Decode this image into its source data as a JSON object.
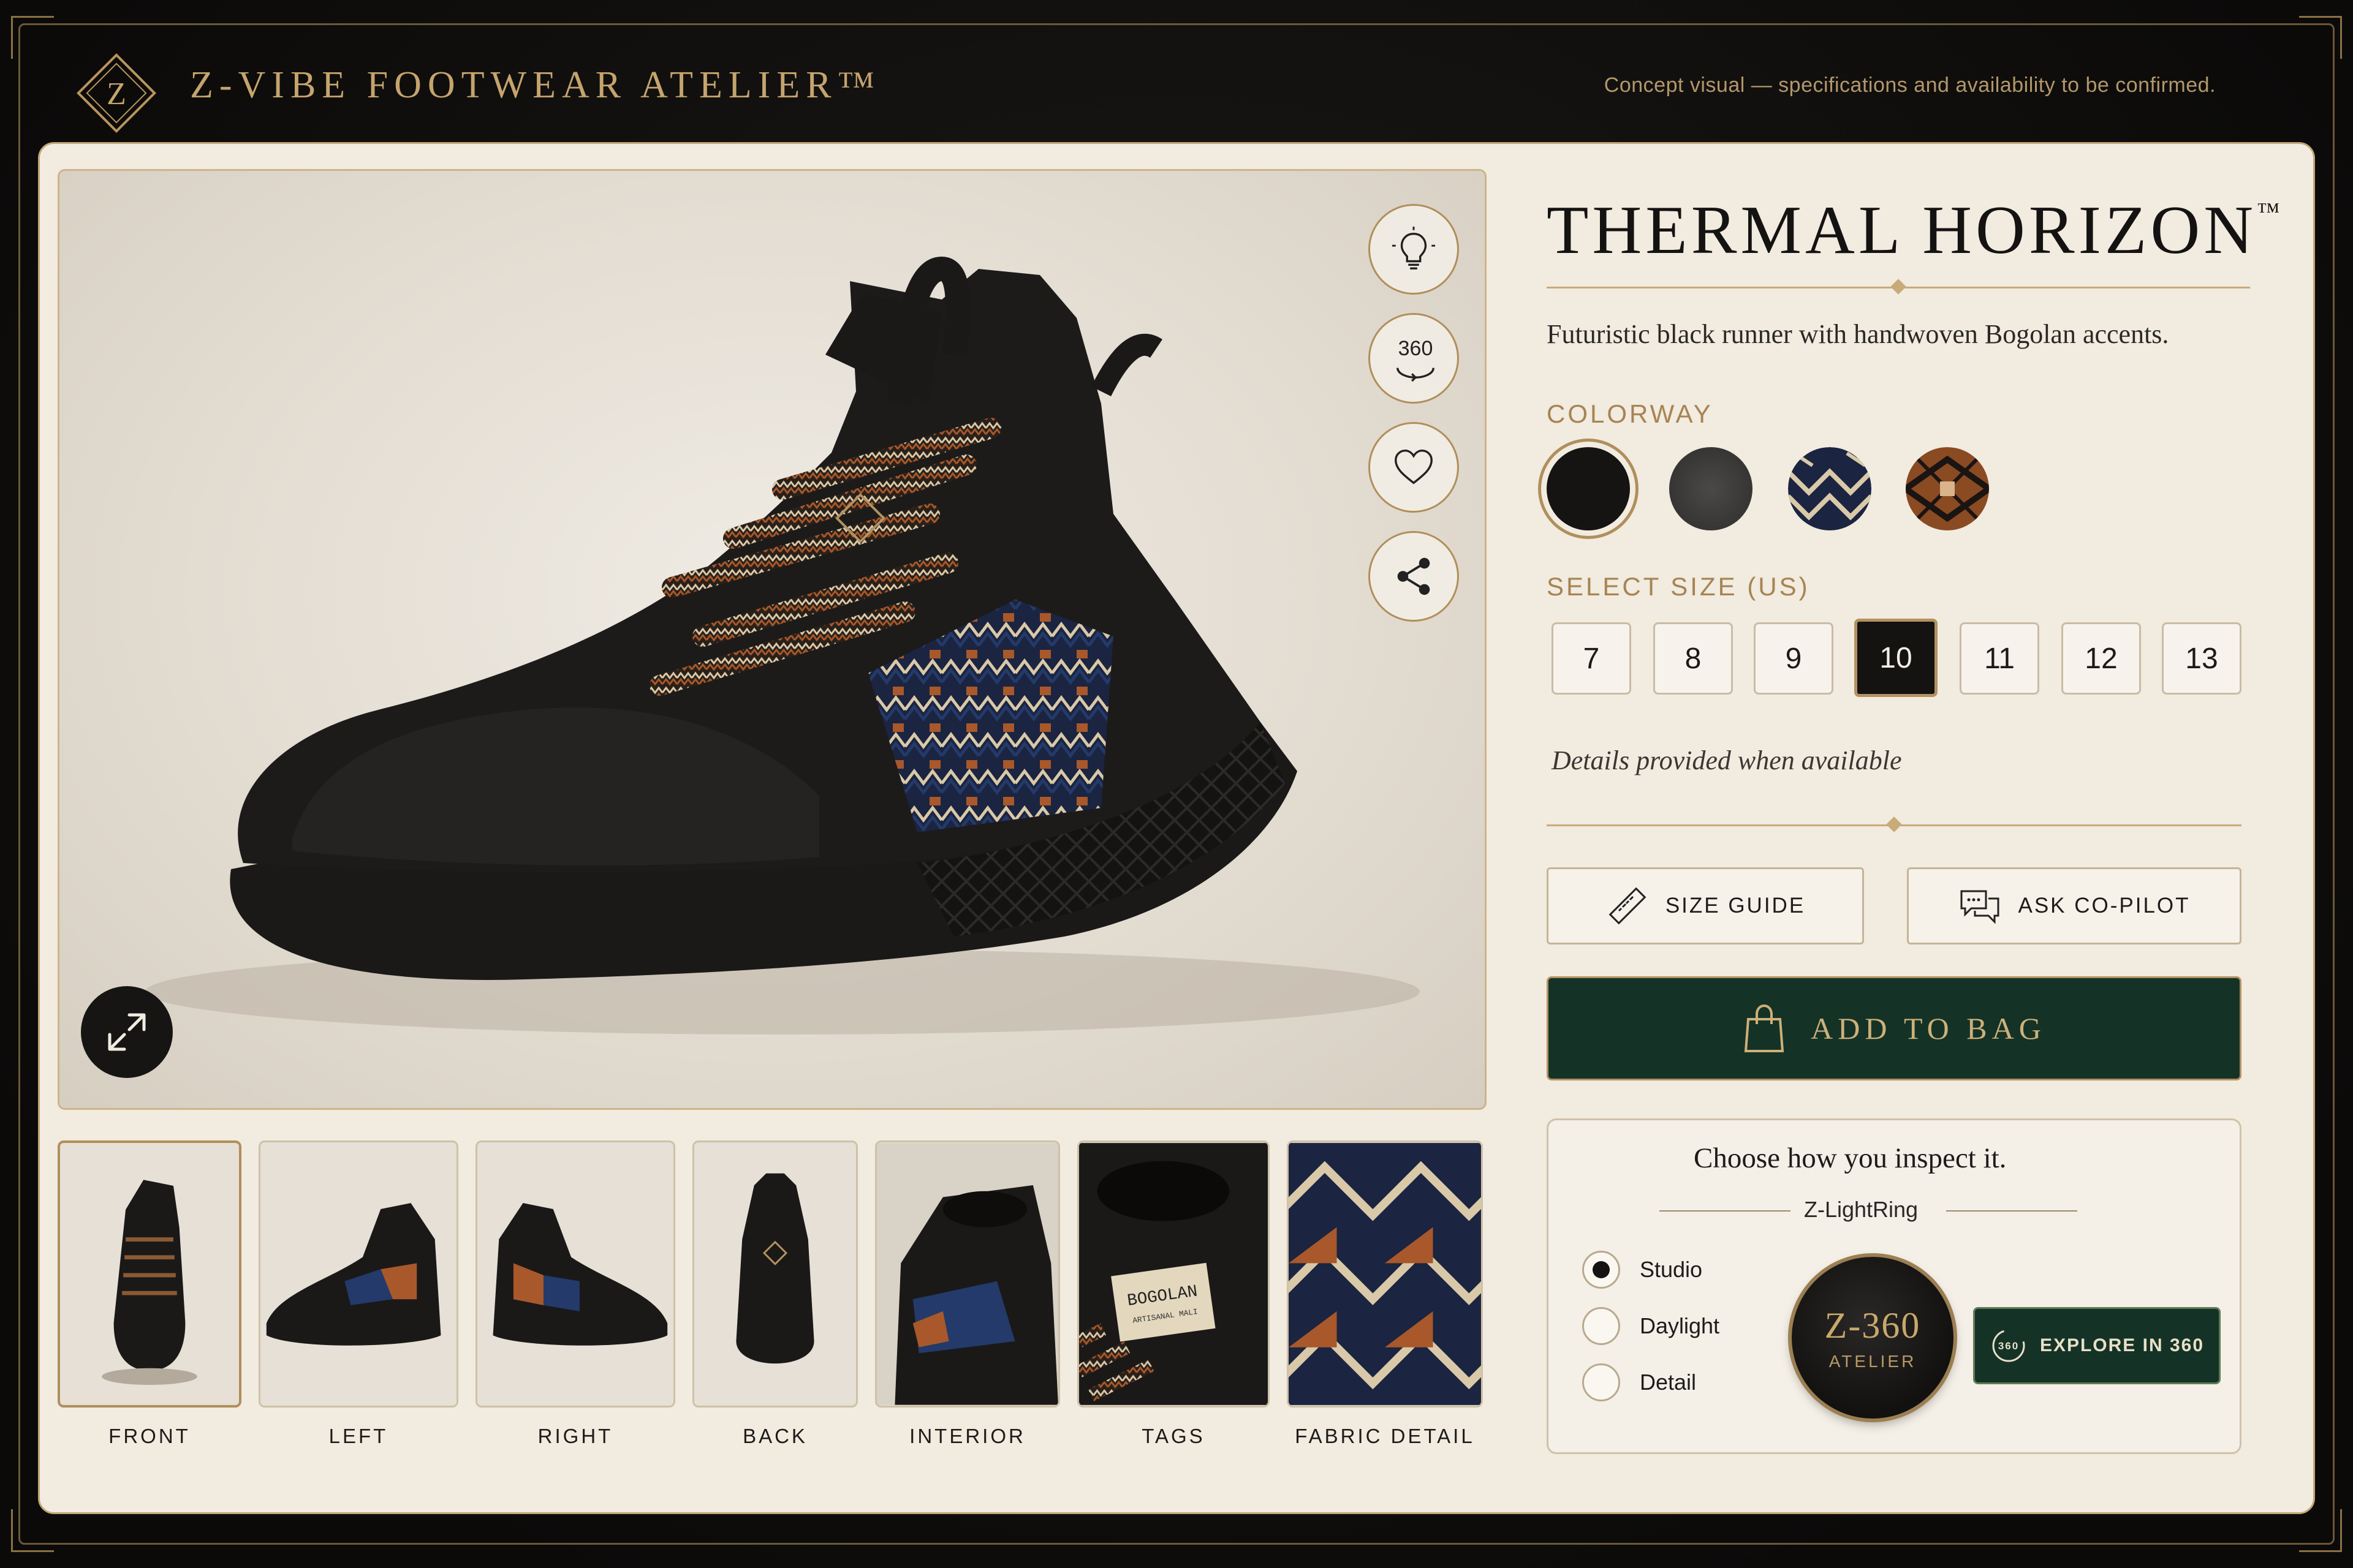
{
  "header": {
    "logo_letter": "Z",
    "brand": "Z-VIBE FOOTWEAR ATELIER™",
    "note": "Concept visual — specifications and availability to be confirmed."
  },
  "hero": {
    "tools": [
      {
        "name": "lightbulb-icon",
        "label": ""
      },
      {
        "name": "rotate-360-icon",
        "label": "360"
      },
      {
        "name": "heart-icon",
        "label": ""
      },
      {
        "name": "share-icon",
        "label": ""
      }
    ],
    "expand_icon": "expand-icon"
  },
  "thumbnails": [
    {
      "label": "FRONT",
      "active": true
    },
    {
      "label": "LEFT",
      "active": false
    },
    {
      "label": "RIGHT",
      "active": false
    },
    {
      "label": "BACK",
      "active": false
    },
    {
      "label": "INTERIOR",
      "active": false
    },
    {
      "label": "TAGS",
      "active": false
    },
    {
      "label": "FABRIC DETAIL",
      "active": false
    }
  ],
  "tag_text": {
    "line1": "BOGOLAN",
    "line2": "ARTISANAL MALI"
  },
  "product": {
    "title": "THERMAL HORIZON",
    "title_mark": "™",
    "subtitle": "Futuristic black runner with handwoven Bogolan accents.",
    "colorway_label": "COLORWAY",
    "colorways": [
      {
        "name": "black",
        "color": "#151413",
        "selected": true
      },
      {
        "name": "charcoal",
        "color": "#3a3937",
        "selected": false
      },
      {
        "name": "indigo-bogolan",
        "color": "#1c2840",
        "selected": false
      },
      {
        "name": "rust-bogolan",
        "color": "#8a4a22",
        "selected": false
      }
    ],
    "size_label": "SELECT SIZE (US)",
    "sizes": [
      "7",
      "8",
      "9",
      "10",
      "11",
      "12",
      "13"
    ],
    "selected_size": "10",
    "details_note": "Details provided when available",
    "size_guide": "SIZE GUIDE",
    "ask_copilot": "ASK CO-PILOT",
    "add_to_bag": "ADD TO BAG"
  },
  "inspect": {
    "title": "Choose how you inspect it.",
    "lightring": "Z-LightRing",
    "options": [
      "Studio",
      "Daylight",
      "Detail"
    ],
    "selected": "Studio",
    "badge_main": "Z-360",
    "badge_sub": "ATELIER",
    "explore_icon_label": "360",
    "explore": "EXPLORE IN 360"
  },
  "colors": {
    "gold": "#c5a46d",
    "forest_green": "#143326",
    "card": "#f1ebe0",
    "bogolan_rust": "#a8582a",
    "bogolan_indigo": "#233a6a",
    "bogolan_cream": "#d9c9a8"
  }
}
